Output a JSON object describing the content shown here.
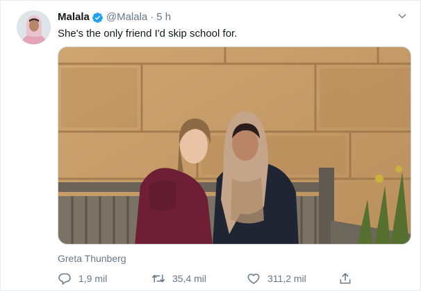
{
  "tweet": {
    "author_name": "Malala",
    "handle": "@Malala",
    "separator": "·",
    "time": "5 h",
    "text": "She's the only friend I'd skip school for.",
    "tagged": "Greta Thunberg",
    "counts": {
      "replies": "1,9 mil",
      "retweets": "35,4 mil",
      "likes": "311,2 mil"
    }
  },
  "icons": {
    "verified": "verified-badge-icon",
    "more": "chevron-down-icon",
    "reply": "reply-icon",
    "retweet": "retweet-icon",
    "like": "heart-icon",
    "share": "share-icon"
  },
  "colors": {
    "accent": "#1da1f2",
    "secondary_text": "#657786",
    "primary_text": "#14171a",
    "border": "#e6ecf0"
  }
}
